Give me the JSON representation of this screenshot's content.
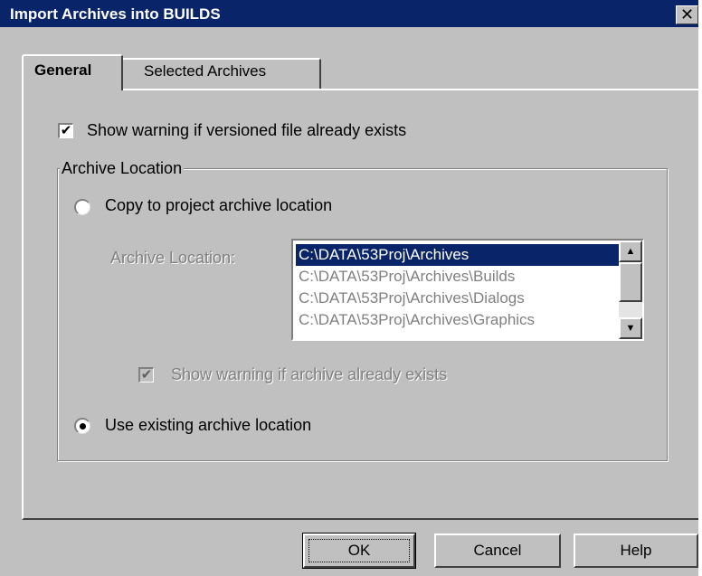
{
  "window": {
    "title": "Import Archives into BUILDS",
    "close_glyph": "✕"
  },
  "tabs": [
    {
      "label": "General",
      "active": true
    },
    {
      "label": "Selected Archives",
      "active": false
    }
  ],
  "general": {
    "show_warning_versioned": {
      "label": "Show warning if versioned file already exists",
      "checked": true
    },
    "archive_location_group": {
      "legend": "Archive Location",
      "copy_option": {
        "label": "Copy to project archive location",
        "selected": false
      },
      "archive_location_label": "Archive Location:",
      "archive_list": {
        "items": [
          "C:\\DATA\\53Proj\\Archives",
          "C:\\DATA\\53Proj\\Archives\\Builds",
          "C:\\DATA\\53Proj\\Archives\\Dialogs",
          "C:\\DATA\\53Proj\\Archives\\Graphics"
        ],
        "selected_index": 0
      },
      "show_warning_archive": {
        "label": "Show warning if archive already exists",
        "checked": true,
        "disabled": true
      },
      "use_existing_option": {
        "label": "Use existing archive location",
        "selected": true
      }
    }
  },
  "buttons": {
    "ok": "OK",
    "cancel": "Cancel",
    "help": "Help"
  },
  "icons": {
    "check": "✔",
    "scroll_up": "▲",
    "scroll_down": "▼"
  },
  "colors": {
    "titlebar": "#0a246a",
    "face": "#c0c0c0",
    "selection": "#0a246a"
  }
}
